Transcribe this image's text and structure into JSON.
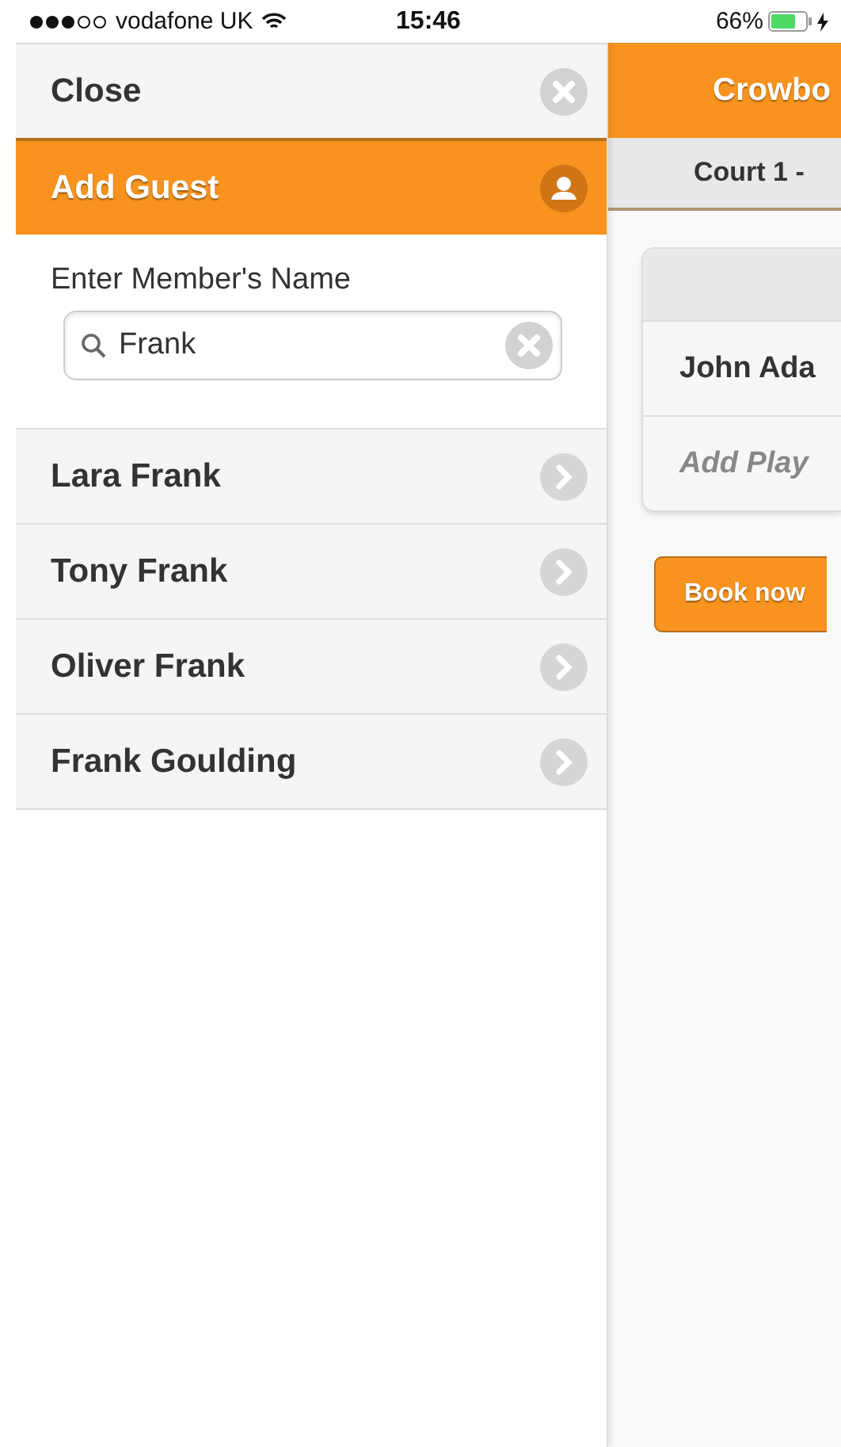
{
  "status_bar": {
    "carrier": "vodafone UK",
    "time": "15:46",
    "battery": "66%"
  },
  "menu": {
    "close": "Close",
    "add_guest": "Add Guest",
    "search_label": "Enter Member's Name",
    "search_value": "Frank",
    "results": [
      {
        "name": "Lara Frank"
      },
      {
        "name": "Tony Frank"
      },
      {
        "name": "Oliver Frank"
      },
      {
        "name": "Frank Goulding"
      }
    ]
  },
  "main": {
    "title": "Crowbo",
    "subtitle": "Court 1 -",
    "players": [
      {
        "name": "John Ada",
        "kind": "player"
      },
      {
        "name": "Add Play",
        "kind": "placeholder"
      }
    ],
    "book_button": "Book now"
  }
}
